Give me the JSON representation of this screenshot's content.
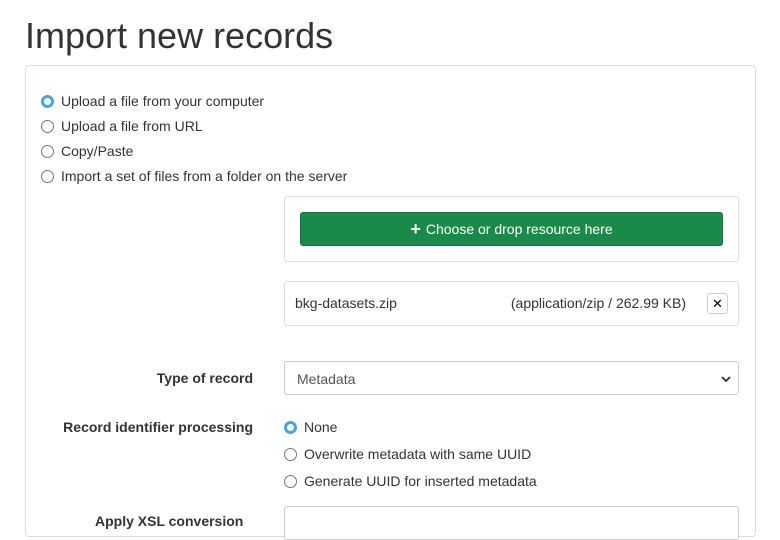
{
  "page": {
    "title": "Import new records"
  },
  "source_options": [
    {
      "label": "Upload a file from your computer",
      "checked": true
    },
    {
      "label": "Upload a file from URL",
      "checked": false
    },
    {
      "label": "Copy/Paste",
      "checked": false
    },
    {
      "label": "Import a set of files from a folder on the server",
      "checked": false
    }
  ],
  "upload": {
    "choose_label": "Choose or drop resource here",
    "plus_icon": "+",
    "file": {
      "name": "bkg-datasets.zip",
      "meta": "(application/zip / 262.99 KB)",
      "remove_icon": "✕"
    }
  },
  "record_type": {
    "label": "Type of record",
    "value": "Metadata"
  },
  "identifier_processing": {
    "label": "Record identifier processing",
    "options": [
      {
        "label": "None",
        "checked": true
      },
      {
        "label": "Overwrite metadata with same UUID",
        "checked": false
      },
      {
        "label": "Generate UUID for inserted metadata",
        "checked": false
      }
    ]
  },
  "xsl": {
    "label_partial": "Apply XSL conversion"
  },
  "colors": {
    "accent": "#4aa3e0",
    "primary_button": "#1a8a4a"
  }
}
